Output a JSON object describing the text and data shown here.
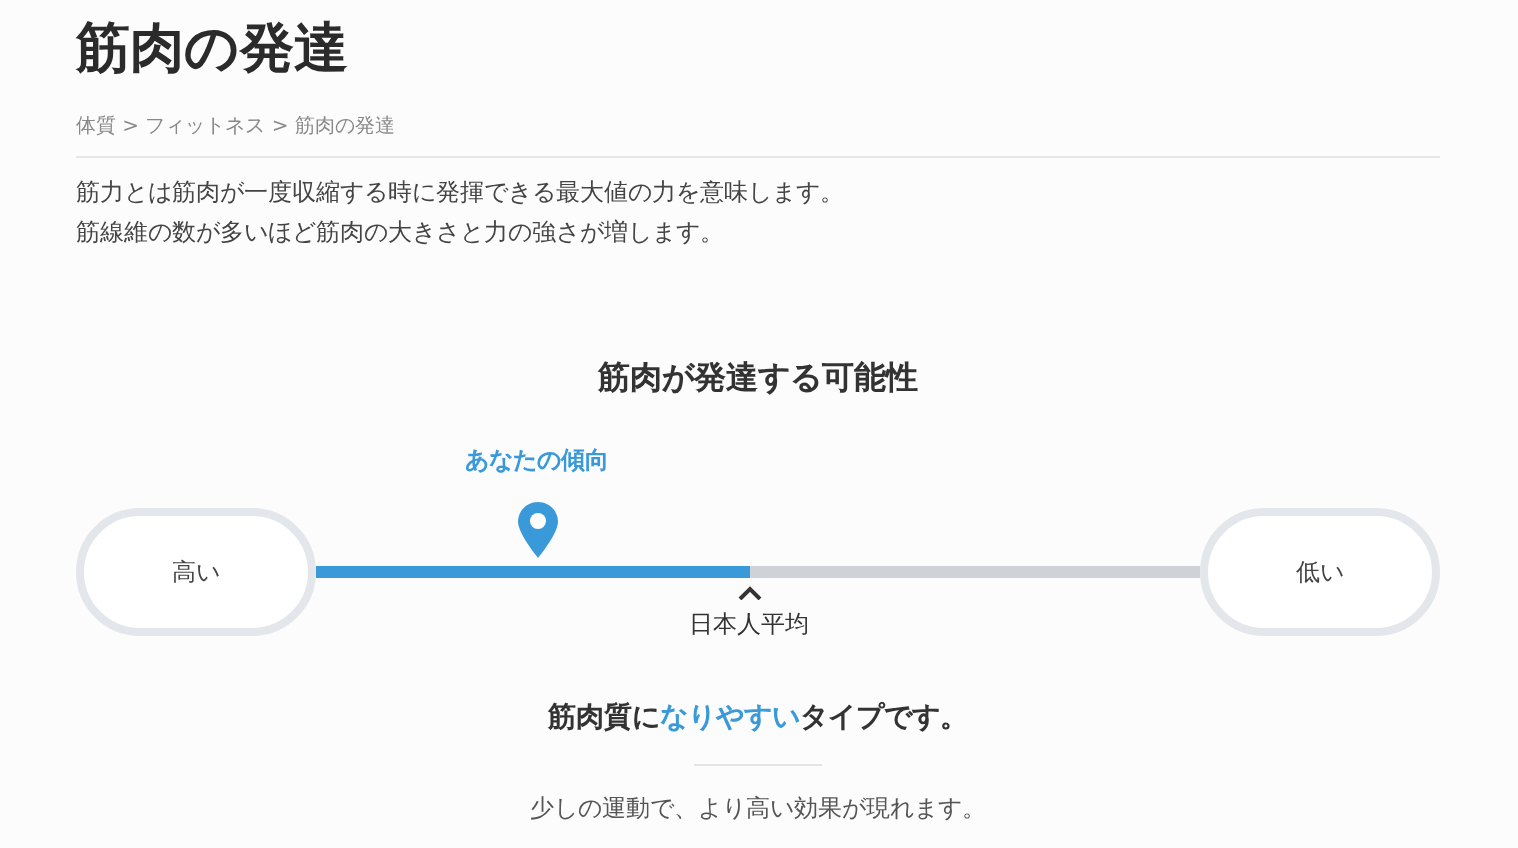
{
  "page": {
    "title": "筋肉の発達"
  },
  "breadcrumb": "体質 > フィットネス > 筋肉の発達",
  "intro": [
    "筋力とは筋肉が一度収縮する時に発揮できる最大値の力を意味します。",
    "筋線維の数が多いほど筋肉の大きさと力の強さが増します。"
  ],
  "scale": {
    "title": "筋肉が発達する可能性",
    "left_label": "高い",
    "right_label": "低い",
    "you": {
      "label": "あなたの傾向",
      "level": 0.25
    },
    "average": {
      "label": "日本人平均",
      "level": 0.49
    }
  },
  "result": {
    "parts": [
      {
        "text": "筋肉質に",
        "highlight": false
      },
      {
        "text": "なりやすい",
        "highlight": true
      },
      {
        "text": "タイプです。",
        "highlight": false
      }
    ],
    "note": "少しの運動で、より高い効果が現れます。"
  }
}
